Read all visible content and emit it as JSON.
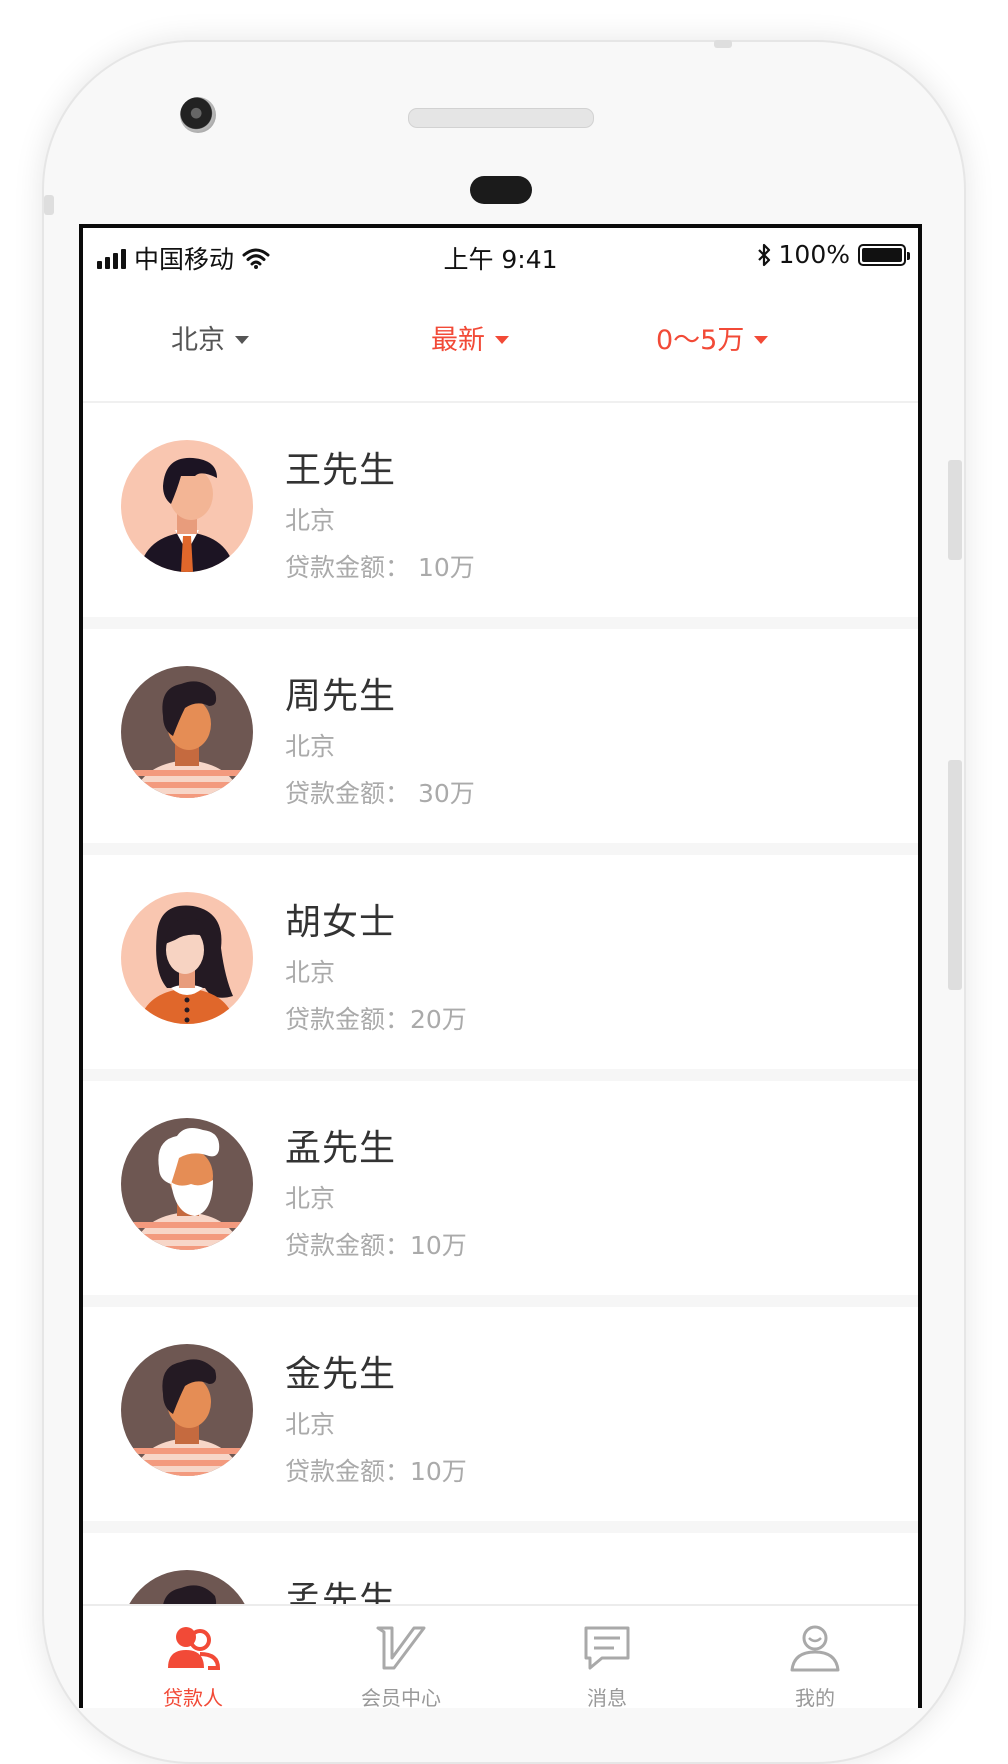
{
  "status_bar": {
    "carrier": "中国移动",
    "time": "上午 9:41",
    "battery_text": "100%",
    "battery_level": 1.0
  },
  "filters": [
    {
      "label": "北京",
      "color": "#555555"
    },
    {
      "label": "最新",
      "color": "#f24a37"
    },
    {
      "label": "0～5万",
      "color": "#f24a37"
    }
  ],
  "borrowers": [
    {
      "name": "王先生",
      "city": "北京",
      "amount": "贷款金额： 10万",
      "avatar": "man-suit-avatar"
    },
    {
      "name": "周先生",
      "city": "北京",
      "amount": "贷款金额： 30万",
      "avatar": "man-striped-shirt-avatar"
    },
    {
      "name": "胡女士",
      "city": "北京",
      "amount": "贷款金额：20万",
      "avatar": "woman-avatar"
    },
    {
      "name": "孟先生",
      "city": "北京",
      "amount": "贷款金额：10万",
      "avatar": "old-man-beard-avatar"
    },
    {
      "name": "金先生",
      "city": "北京",
      "amount": "贷款金额：10万",
      "avatar": "man-striped-shirt-avatar"
    },
    {
      "name": "孟先生",
      "city": "",
      "amount": "",
      "avatar": "man-striped-shirt-avatar"
    }
  ],
  "tabs": [
    {
      "label": "贷款人",
      "icon": "people-icon",
      "active": true
    },
    {
      "label": "会员中心",
      "icon": "vip-icon",
      "active": false
    },
    {
      "label": "消息",
      "icon": "message-icon",
      "active": false
    },
    {
      "label": "我的",
      "icon": "profile-icon",
      "active": false
    }
  ],
  "colors": {
    "accent": "#f24a37",
    "secondary_text": "#aaaaaa",
    "primary_text": "#333333"
  }
}
